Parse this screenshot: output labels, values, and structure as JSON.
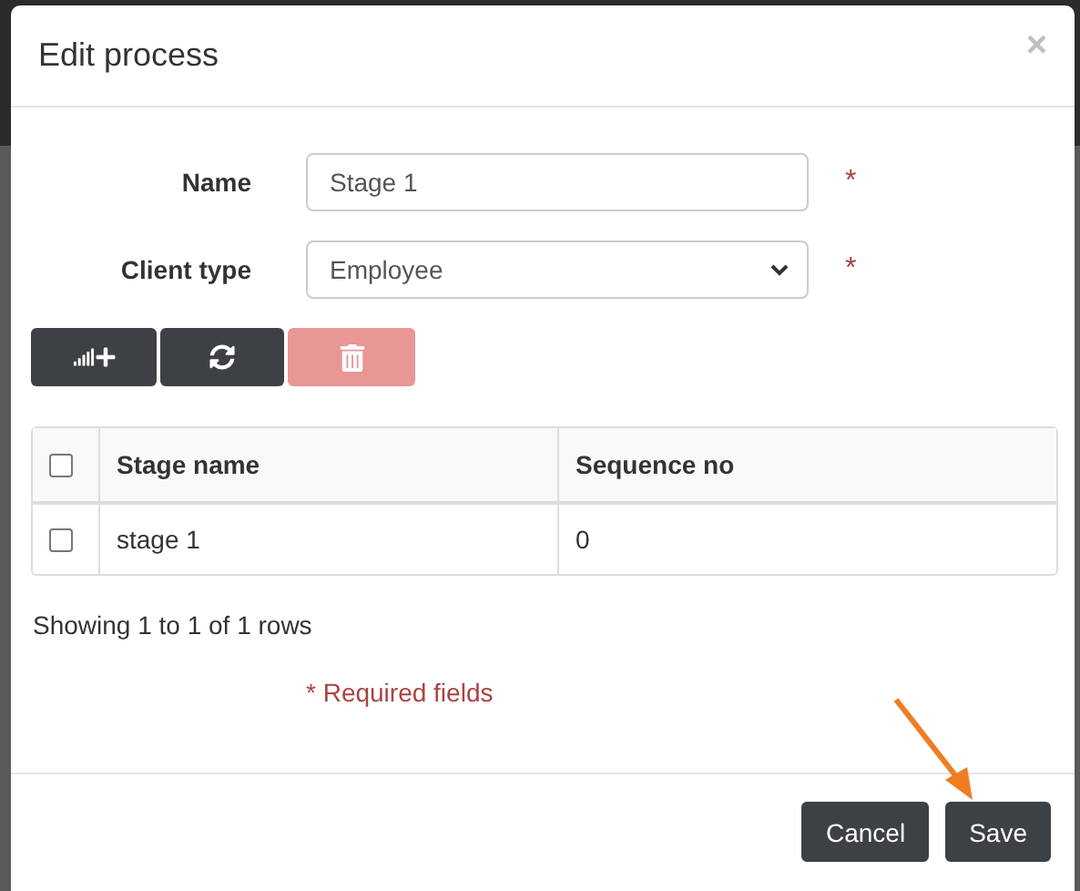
{
  "dialog": {
    "title": "Edit process",
    "close": "×"
  },
  "form": [
    {
      "kind": "input",
      "label": "Name",
      "value": "Stage 1",
      "required_mark": "*"
    },
    {
      "kind": "select",
      "label": "Client type",
      "value": "Employee",
      "required_mark": "*"
    }
  ],
  "toolbar": [
    {
      "kind": "add",
      "disabled": false
    },
    {
      "kind": "refresh",
      "disabled": false
    },
    {
      "kind": "delete",
      "disabled": true
    }
  ],
  "table": {
    "header_checked": false,
    "columns": [
      "Stage name",
      "Sequence no"
    ],
    "rows": [
      {
        "checked": false,
        "cells": [
          "stage 1",
          "0"
        ]
      }
    ]
  },
  "pagination": "Showing 1 to 1 of 1 rows",
  "required_note": "* Required fields",
  "buttons": [
    "Cancel",
    "Save"
  ],
  "annotation": {
    "kind": "arrow"
  }
}
